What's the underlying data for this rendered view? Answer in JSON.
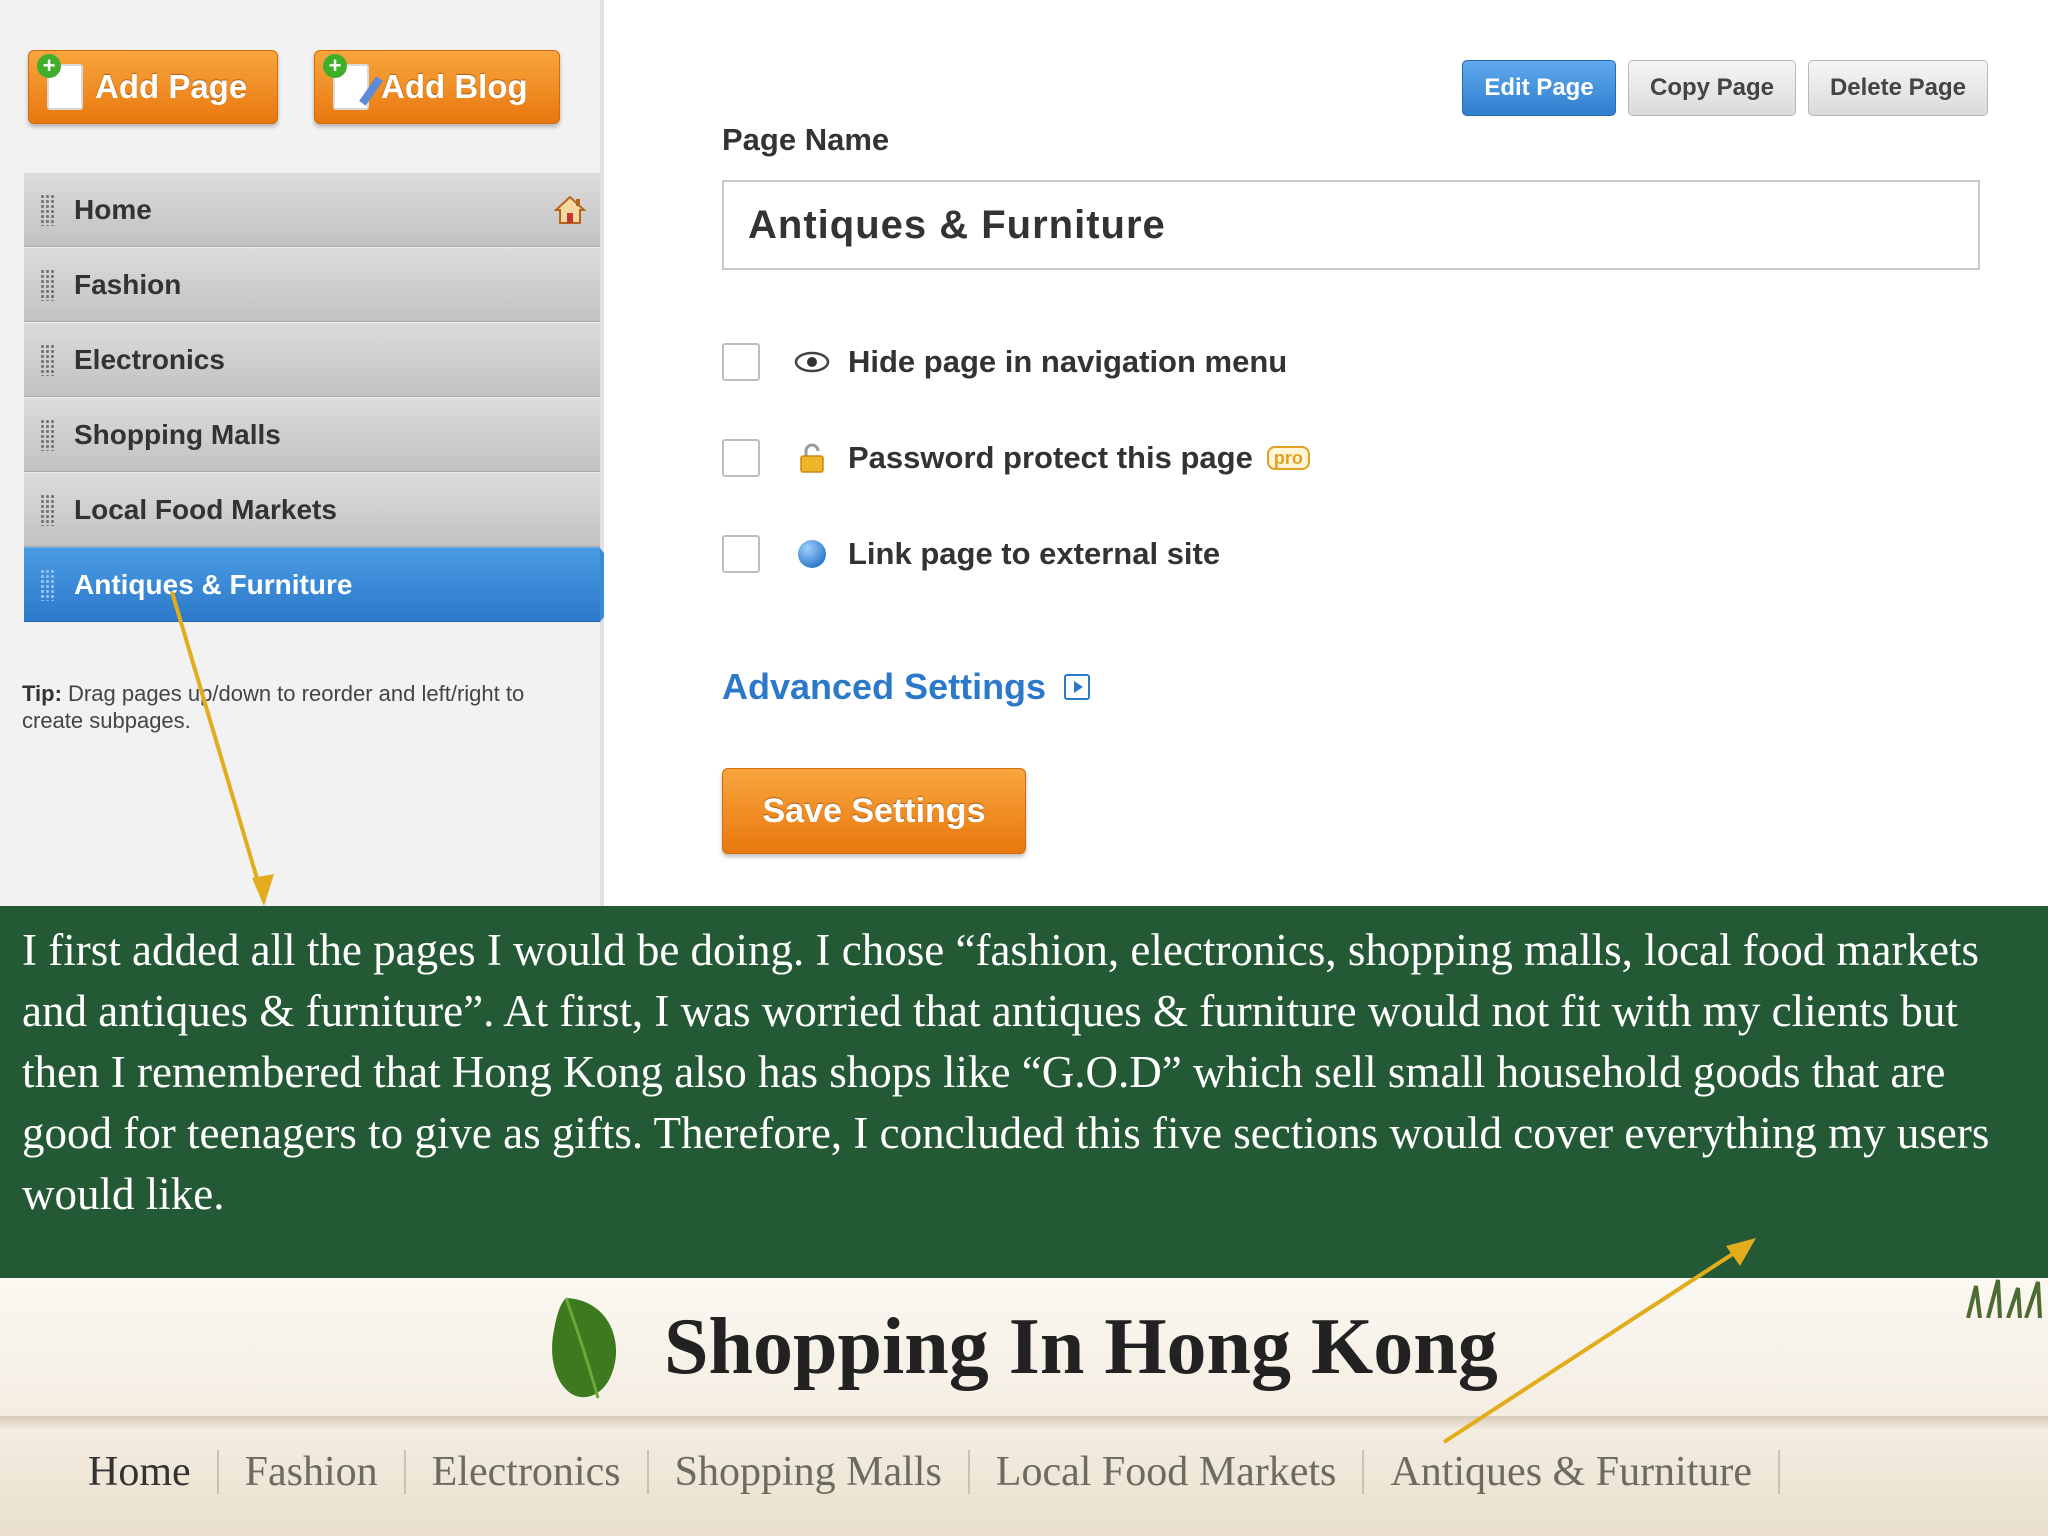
{
  "sidebar": {
    "add_page_label": "Add Page",
    "add_blog_label": "Add Blog",
    "pages": [
      {
        "label": "Home",
        "icon": "house-icon"
      },
      {
        "label": "Fashion"
      },
      {
        "label": "Electronics"
      },
      {
        "label": "Shopping Malls"
      },
      {
        "label": "Local Food Markets"
      },
      {
        "label": "Antiques & Furniture",
        "active": true
      }
    ],
    "tip_label": "Tip:",
    "tip_text": "Drag pages up/down to reorder and left/right to create subpages."
  },
  "toolbar": {
    "edit_label": "Edit Page",
    "copy_label": "Copy Page",
    "delete_label": "Delete Page"
  },
  "form": {
    "page_name_label": "Page Name",
    "page_name_value": "Antiques & Furniture",
    "options": [
      {
        "label": "Hide page in navigation menu",
        "icon": "eye-icon",
        "checked": false
      },
      {
        "label": "Password protect this page",
        "icon": "lock-icon",
        "checked": false,
        "badge": "pro"
      },
      {
        "label": "Link page to external site",
        "icon": "globe-icon",
        "checked": false
      }
    ],
    "advanced_label": "Advanced Settings",
    "save_label": "Save Settings"
  },
  "caption": {
    "text": "I first added all the pages I would be doing. I chose “fashion, electronics, shopping malls, local food markets and antiques & furniture”. At first, I was worried that antiques & furniture would not fit with my clients but then I remembered that Hong Kong also has shops like “G.O.D” which sell small household goods that are good for teenagers to give as gifts. Therefore, I concluded this five sections would cover everything my users would like."
  },
  "site": {
    "title": "Shopping In Hong Kong",
    "nav": [
      "Home",
      "Fashion",
      "Electronics",
      "Shopping Malls",
      "Local Food Markets",
      "Antiques & Furniture"
    ]
  },
  "colors": {
    "accent_orange": "#f08a1e",
    "accent_blue": "#3a8ad6",
    "caption_bg": "#235a35",
    "arrow": "#e2ac1c"
  }
}
